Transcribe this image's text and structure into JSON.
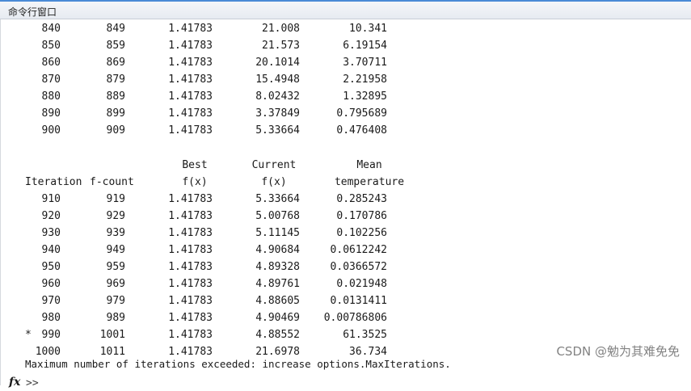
{
  "window": {
    "title": "命令行窗口"
  },
  "rows_top": [
    [
      "840",
      "849",
      "1.41783",
      "21.008",
      "10.341"
    ],
    [
      "850",
      "859",
      "1.41783",
      "21.573",
      "6.19154"
    ],
    [
      "860",
      "869",
      "1.41783",
      "20.1014",
      "3.70711"
    ],
    [
      "870",
      "879",
      "1.41783",
      "15.4948",
      "2.21958"
    ],
    [
      "880",
      "889",
      "1.41783",
      "8.02432",
      "1.32895"
    ],
    [
      "890",
      "899",
      "1.41783",
      "3.37849",
      "0.795689"
    ],
    [
      "900",
      "909",
      "1.41783",
      "5.33664",
      "0.476408"
    ]
  ],
  "header": {
    "line1": {
      "col3": "Best",
      "col4": "Current",
      "col5": "Mean"
    },
    "line2": {
      "col1": "Iteration",
      "col2": "f-count",
      "col3": "f(x)",
      "col4": "f(x)",
      "col5": "temperature"
    }
  },
  "rows_bottom": [
    {
      "mark": "",
      "cells": [
        "910",
        "919",
        "1.41783",
        "5.33664",
        "0.285243"
      ]
    },
    {
      "mark": "",
      "cells": [
        "920",
        "929",
        "1.41783",
        "5.00768",
        "0.170786"
      ]
    },
    {
      "mark": "",
      "cells": [
        "930",
        "939",
        "1.41783",
        "5.11145",
        "0.102256"
      ]
    },
    {
      "mark": "",
      "cells": [
        "940",
        "949",
        "1.41783",
        "4.90684",
        "0.0612242"
      ]
    },
    {
      "mark": "",
      "cells": [
        "950",
        "959",
        "1.41783",
        "4.89328",
        "0.0366572"
      ]
    },
    {
      "mark": "",
      "cells": [
        "960",
        "969",
        "1.41783",
        "4.89761",
        "0.021948"
      ]
    },
    {
      "mark": "",
      "cells": [
        "970",
        "979",
        "1.41783",
        "4.88605",
        "0.0131411"
      ]
    },
    {
      "mark": "",
      "cells": [
        "980",
        "989",
        "1.41783",
        "4.90469",
        "0.00786806"
      ]
    },
    {
      "mark": "*",
      "cells": [
        "990",
        "1001",
        "1.41783",
        "4.88552",
        "61.3525"
      ]
    },
    {
      "mark": "",
      "cells": [
        "1000",
        "1011",
        "1.41783",
        "21.6978",
        "36.734"
      ]
    }
  ],
  "message": "Maximum number of iterations exceeded: increase options.MaxIterations.",
  "prompt": {
    "fx": "fx",
    "symbol": ">>"
  },
  "watermark": "CSDN @勉为其难免免"
}
